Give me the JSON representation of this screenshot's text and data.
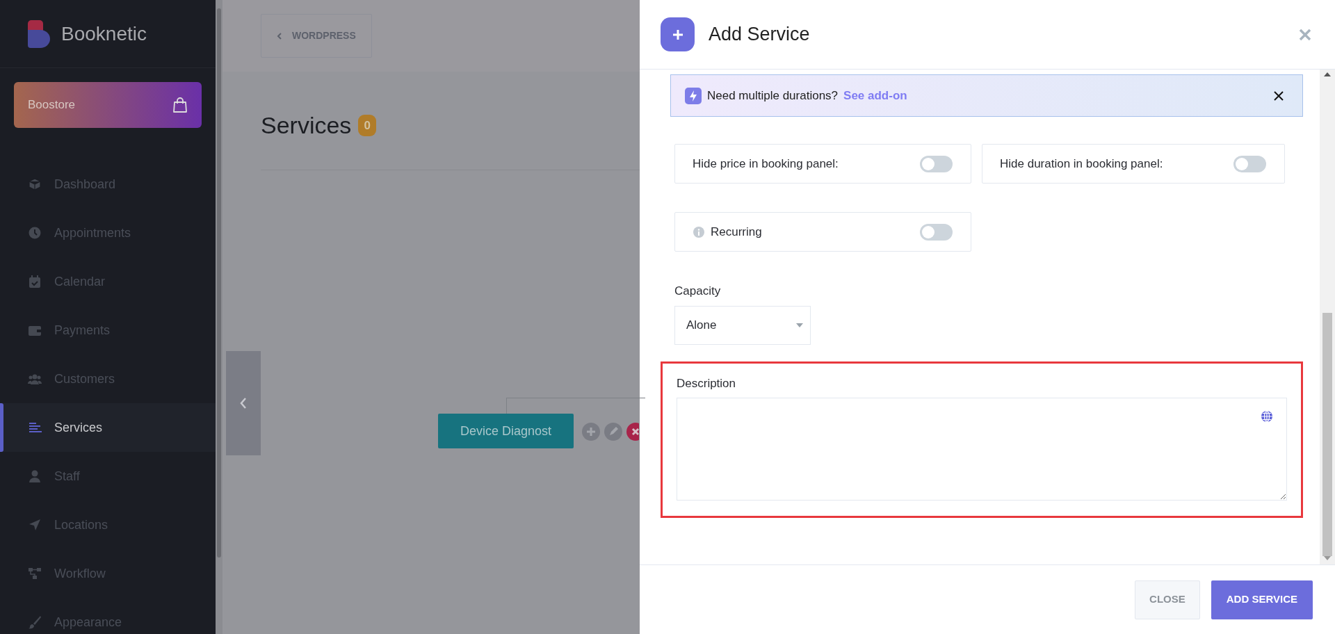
{
  "sidebar": {
    "brand": "Booknetic",
    "store": "Boostore",
    "items": [
      {
        "label": "Dashboard",
        "selected": false
      },
      {
        "label": "Appointments",
        "selected": false
      },
      {
        "label": "Calendar",
        "selected": false
      },
      {
        "label": "Payments",
        "selected": false
      },
      {
        "label": "Customers",
        "selected": false
      },
      {
        "label": "Services",
        "selected": true
      },
      {
        "label": "Staff",
        "selected": false
      },
      {
        "label": "Locations",
        "selected": false
      },
      {
        "label": "Workflow",
        "selected": false
      },
      {
        "label": "Appearance",
        "selected": false
      }
    ]
  },
  "topbar": {
    "back_button": "WORDPRESS"
  },
  "page": {
    "title": "Services",
    "count": "0",
    "node": "Device Diagnost"
  },
  "panel": {
    "title": "Add Service",
    "notice": {
      "text": "Need multiple durations?",
      "link": "See add-on"
    },
    "toggles": [
      {
        "label": "Hide price in booking panel:",
        "on": false,
        "info": false
      },
      {
        "label": "Hide duration in booking panel:",
        "on": false,
        "info": false
      },
      {
        "label": "Recurring",
        "on": false,
        "info": true
      }
    ],
    "capacity": {
      "label": "Capacity",
      "value": "Alone"
    },
    "description": {
      "label": "Description",
      "highlighted": true
    },
    "buttons": [
      {
        "label": "CLOSE",
        "kind": "secondary"
      },
      {
        "label": "ADD SERVICE",
        "kind": "primary"
      }
    ]
  }
}
